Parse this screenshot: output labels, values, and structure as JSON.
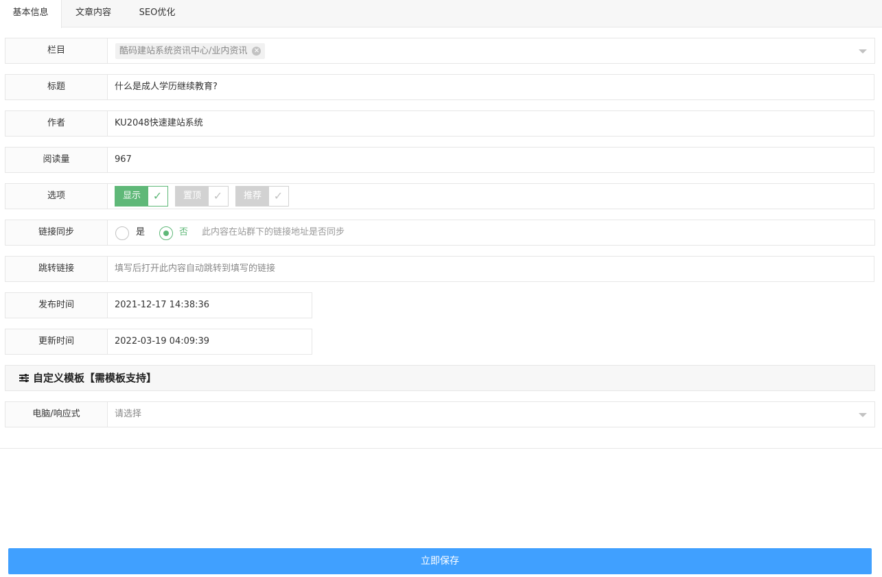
{
  "tabs": [
    {
      "label": "基本信息",
      "active": true
    },
    {
      "label": "文章内容",
      "active": false
    },
    {
      "label": "SEO优化",
      "active": false
    }
  ],
  "form": {
    "column": {
      "label": "栏目",
      "value": "酷码建站系统资讯中心/业内资讯"
    },
    "title": {
      "label": "标题",
      "value": "什么是成人学历继续教育?"
    },
    "author": {
      "label": "作者",
      "value": "KU2048快速建站系统"
    },
    "views": {
      "label": "阅读量",
      "value": "967"
    },
    "options": {
      "label": "选项",
      "items": [
        {
          "label": "显示",
          "checked": true
        },
        {
          "label": "置顶",
          "checked": false
        },
        {
          "label": "推荐",
          "checked": false
        }
      ]
    },
    "link_sync": {
      "label": "链接同步",
      "yes": "是",
      "no": "否",
      "selected": "否",
      "hint": "此内容在站群下的链接地址是否同步"
    },
    "redirect": {
      "label": "跳转链接",
      "value": "",
      "placeholder": "填写后打开此内容自动跳转到填写的链接"
    },
    "publish_time": {
      "label": "发布时间",
      "value": "2021-12-17 14:38:36"
    },
    "update_time": {
      "label": "更新时间",
      "value": "2022-03-19 04:09:39"
    }
  },
  "custom_template": {
    "header": "自定义模板【需模板支持】",
    "icon": "sliders-icon",
    "pc": {
      "label": "电脑/响应式",
      "placeholder": "请选择"
    }
  },
  "save_button": "立即保存",
  "colors": {
    "accent_green": "#5fb878",
    "save_blue": "#40a0ff",
    "disabled_gray": "#d2d2d2"
  }
}
